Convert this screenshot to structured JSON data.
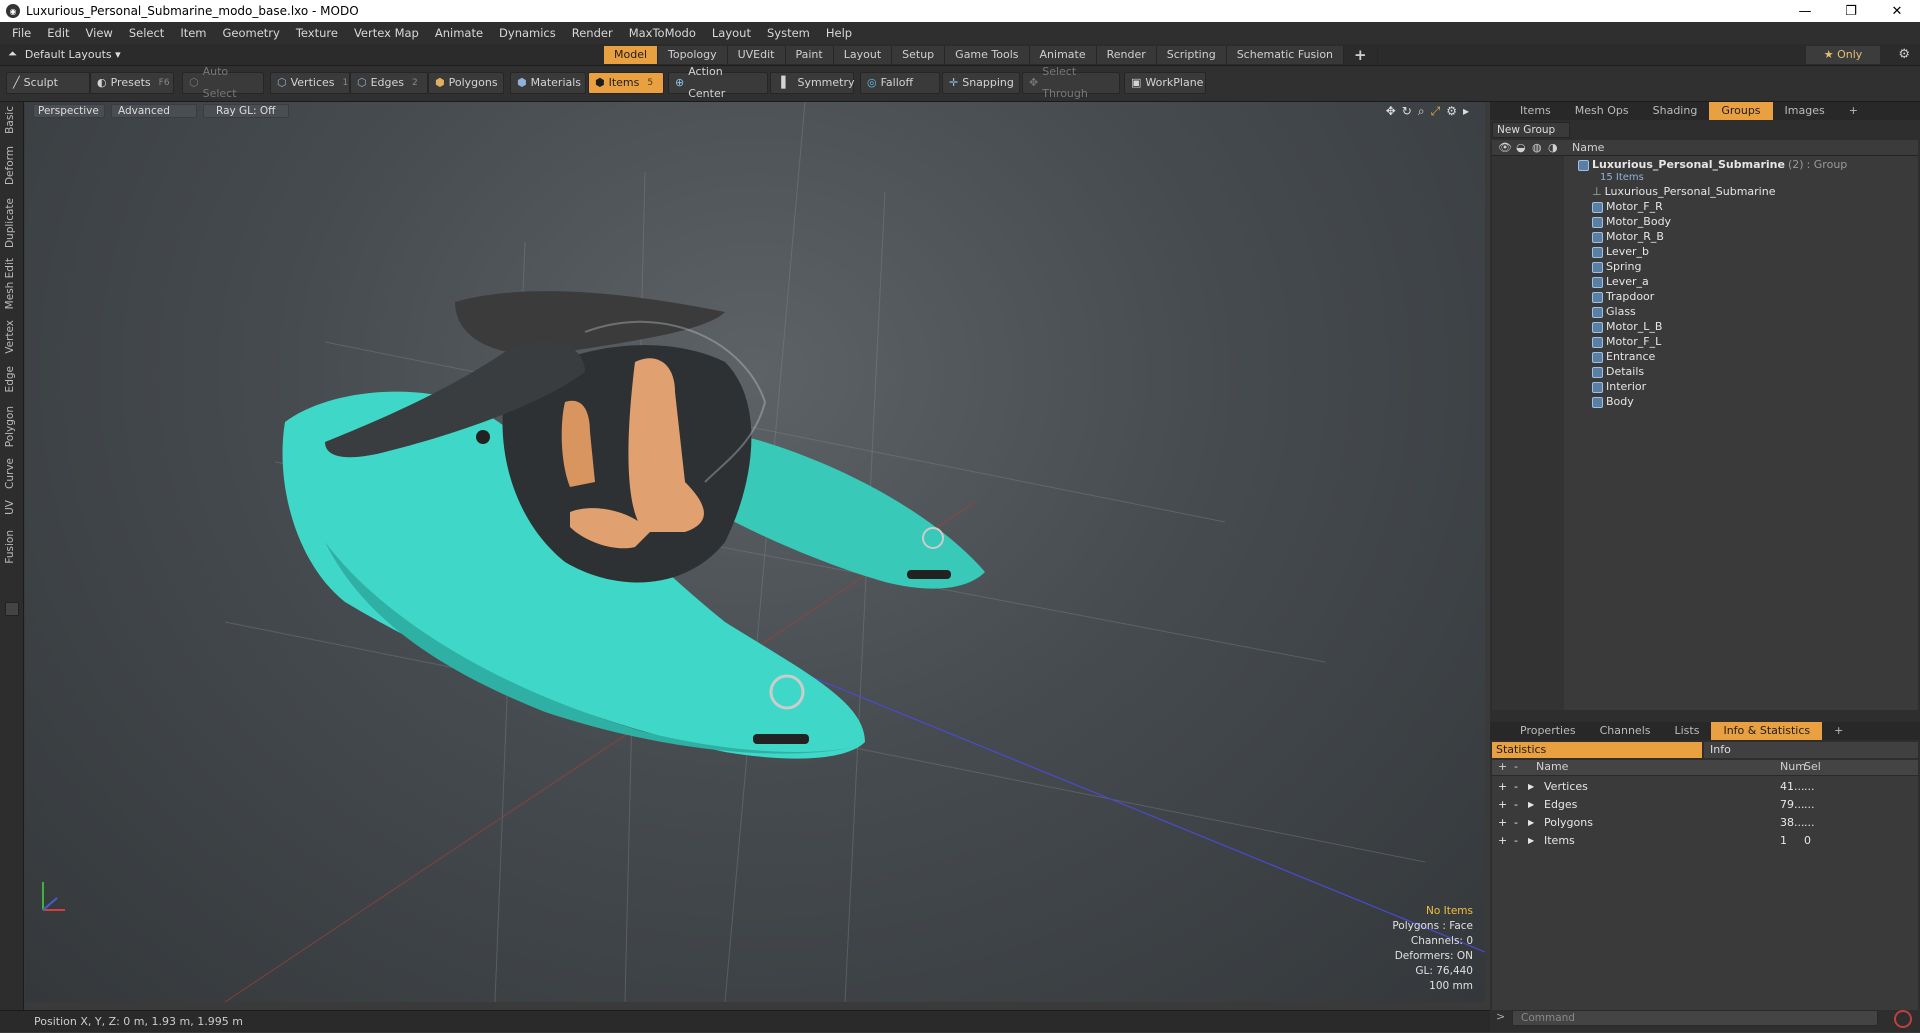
{
  "window": {
    "title": "Luxurious_Personal_Submarine_modo_base.lxo - MODO"
  },
  "menu": [
    "File",
    "Edit",
    "View",
    "Select",
    "Item",
    "Geometry",
    "Texture",
    "Vertex Map",
    "Animate",
    "Dynamics",
    "Render",
    "MaxToModo",
    "Layout",
    "System",
    "Help"
  ],
  "layout": {
    "dropdown": "Default Layouts ▾",
    "only": "★ Only"
  },
  "mode_tabs": [
    "Model",
    "Topology",
    "UVEdit",
    "Paint",
    "Layout",
    "Setup",
    "Game Tools",
    "Animate",
    "Render",
    "Scripting",
    "Schematic Fusion"
  ],
  "mode_tab_plus": "+",
  "toolbar": {
    "sculpt": "Sculpt",
    "presets": "Presets",
    "presets_key": "F6",
    "auto_select": "Auto Select",
    "vertices": "Vertices",
    "vertices_num": "1",
    "edges": "Edges",
    "edges_num": "2",
    "polygons": "Polygons",
    "materials": "Materials",
    "items": "Items",
    "items_num": "5",
    "action_center": "Action Center",
    "symmetry": "Symmetry",
    "falloff": "Falloff",
    "snapping": "Snapping",
    "select_through": "Select Through",
    "workplane": "WorkPlane"
  },
  "left_tabs": [
    "Basic",
    "Deform",
    "Duplicate",
    "Mesh Edit",
    "Vertex",
    "Edge",
    "Polygon",
    "Curve",
    "UV",
    "Fusion"
  ],
  "viewport": {
    "buttons": [
      "Perspective",
      "Advanced",
      "Ray GL: Off"
    ],
    "info": {
      "selection": "No Items",
      "polygons": "Polygons : Face",
      "channels": "Channels: 0",
      "deformers": "Deformers: ON",
      "gl": "GL: 76,440",
      "scale": "100 mm"
    }
  },
  "status": {
    "position": "Position X, Y, Z:   0 m, 1.93 m, 1.995 m"
  },
  "top_panel": {
    "tabs": [
      "Items",
      "Mesh Ops",
      "Shading",
      "Groups",
      "Images"
    ],
    "active_tab": "Groups",
    "new_group": "New Group",
    "col_name": "Name",
    "group": {
      "name": "Luxurious_Personal_Submarine",
      "count": "(2)",
      "type": ": Group",
      "items": "15 Items"
    },
    "children": [
      "Luxurious_Personal_Submarine",
      "Motor_F_R",
      "Motor_Body",
      "Motor_R_B",
      "Lever_b",
      "Spring",
      "Lever_a",
      "Trapdoor",
      "Glass",
      "Motor_L_B",
      "Motor_F_L",
      "Entrance",
      "Details",
      "Interior",
      "Body"
    ]
  },
  "bottom_panel": {
    "tabs": [
      "Properties",
      "Channels",
      "Lists",
      "Info & Statistics"
    ],
    "active_tab": "Info & Statistics",
    "statistics_tab": "Statistics",
    "info_tab": "Info",
    "columns": {
      "name": "Name",
      "num": "Num",
      "sel": "Sel"
    },
    "rows": [
      {
        "name": "Vertices",
        "num": "41...",
        "sel": "..."
      },
      {
        "name": "Edges",
        "num": "79...",
        "sel": "..."
      },
      {
        "name": "Polygons",
        "num": "38...",
        "sel": "..."
      },
      {
        "name": "Items",
        "num": "1",
        "sel": "0"
      }
    ],
    "command_placeholder": "Command"
  },
  "colors": {
    "accent": "#e8a040",
    "hull": "#3fd8c8",
    "seat": "#e0a070",
    "canopy": "#3b3b3b"
  }
}
